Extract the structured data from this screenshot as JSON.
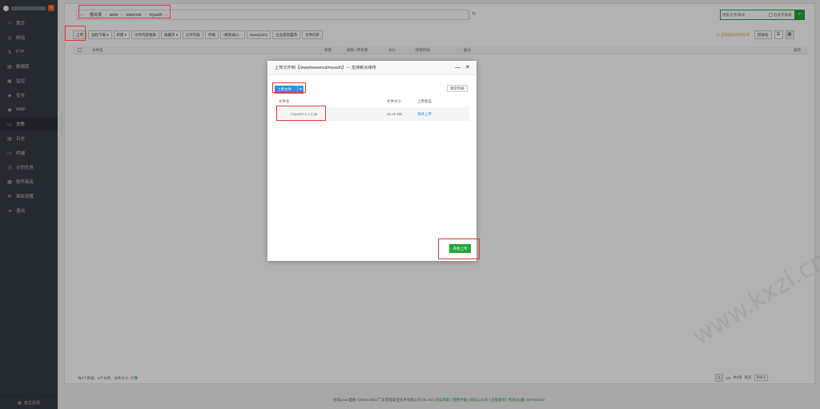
{
  "sidebar": {
    "badge": "6",
    "items": [
      {
        "label": "首页",
        "icon": "home-icon",
        "glyph": "⌂"
      },
      {
        "label": "网站",
        "icon": "globe-icon",
        "glyph": "◎"
      },
      {
        "label": "FTP",
        "icon": "ftp-icon",
        "glyph": "⇅"
      },
      {
        "label": "数据库",
        "icon": "database-icon",
        "glyph": "▤"
      },
      {
        "label": "监控",
        "icon": "monitor-icon",
        "glyph": "▣"
      },
      {
        "label": "安全",
        "icon": "shield-icon",
        "glyph": "◈"
      },
      {
        "label": "WAF",
        "icon": "waf-icon",
        "glyph": "◉"
      },
      {
        "label": "文件",
        "icon": "folder-icon",
        "glyph": "▭"
      },
      {
        "label": "日志",
        "icon": "log-icon",
        "glyph": "▤"
      },
      {
        "label": "终端",
        "icon": "terminal-icon",
        "glyph": "▭"
      },
      {
        "label": "计划任务",
        "icon": "clock-icon",
        "glyph": "◷"
      },
      {
        "label": "软件商店",
        "icon": "grid-icon",
        "glyph": "▦"
      },
      {
        "label": "面板设置",
        "icon": "gear-icon",
        "glyph": "⚙"
      },
      {
        "label": "退出",
        "icon": "logout-icon",
        "glyph": "⇥"
      }
    ],
    "active_index": 7,
    "bottom_label": "意见反馈"
  },
  "path": {
    "crumbs": [
      "根目录",
      "www",
      "wwwroot",
      "myauth"
    ],
    "refresh_glyph": "↻",
    "back_glyph": "←"
  },
  "search": {
    "placeholder": "搜索文件/目录",
    "include_sub": "包含子目录",
    "button_glyph": "⌕"
  },
  "toolbar": {
    "buttons": [
      "上传",
      "远程下载 ▾",
      "新建 ▾",
      "文件内容搜索",
      "收藏夹 ▾",
      "分享列表",
      "终端",
      "/根目录(4...",
      "/www(33G)",
      "企业级防篡改",
      "文件同步"
    ],
    "warning": "⊕ 当前面板权限检测",
    "recycle": "回收站",
    "list_view": "☰",
    "grid_view": "▦"
  },
  "table": {
    "headers": {
      "name": "文件名",
      "perm": "权限",
      "owner": "权限 / 所有者",
      "size": "大小",
      "modified": "修改时间",
      "remark": "备注",
      "actions": "操作"
    }
  },
  "status": {
    "summary": "共0个目录，0个文件，文件大小:",
    "calc": "计算"
  },
  "pager": {
    "current": "1",
    "info": "1/0",
    "total": "共0条",
    "per_page_label": "每页",
    "per_page": "500 ▾"
  },
  "copyright": {
    "text": "宝塔Linux面板 ©2014-2023 广东堡塔安全技术有限公司 (bt.cn)",
    "links": [
      "论坛求助",
      "使用手册",
      "微信公众号",
      "正版查询"
    ],
    "qq": "售后QQ群: 907340327"
  },
  "dialog": {
    "title": "上传文件到【/www/wwwroot/myauth】--- 支持断点续传",
    "minimize": "—",
    "close": "✕",
    "upload_label": "上传文件",
    "upload_caret": "▾",
    "clear_label": "清空列表",
    "headers": {
      "name": "文件名",
      "size": "文件大小",
      "status": "上传状态"
    },
    "files": [
      {
        "name": "/myauth-1.1.4.jar",
        "size": "45.28 MB",
        "status": "等待上传"
      }
    ],
    "start_label": "开始上传"
  },
  "watermark": "www.kxzi.cn"
}
